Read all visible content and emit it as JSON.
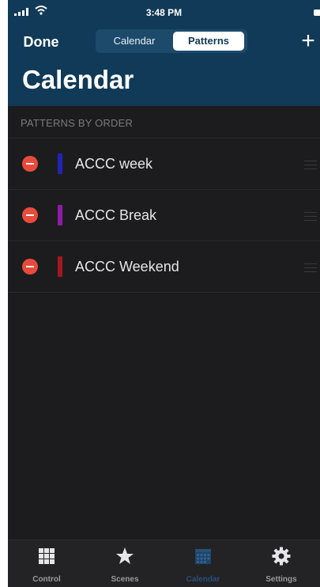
{
  "status_bar": {
    "time": "3:48 PM"
  },
  "nav": {
    "done_label": "Done",
    "add_label": "+"
  },
  "segments": [
    {
      "label": "Calendar",
      "selected": false
    },
    {
      "label": "Patterns",
      "selected": true
    }
  ],
  "title": "Calendar",
  "section_header": "PATTERNS BY ORDER",
  "patterns": [
    {
      "name": "ACCC  week",
      "color": "#2323b5"
    },
    {
      "name": "ACCC Break",
      "color": "#8f1aa6"
    },
    {
      "name": "ACCC Weekend",
      "color": "#a3181f"
    }
  ],
  "tabbar": [
    {
      "label": "Control",
      "icon": "grid-icon"
    },
    {
      "label": "Scenes",
      "icon": "star-icon"
    },
    {
      "label": "Calendar",
      "icon": "calendar-icon",
      "active": true
    },
    {
      "label": "Settings",
      "icon": "gear-icon"
    }
  ],
  "colors": {
    "header_bg": "#103a57",
    "list_bg": "#1c1c1e",
    "delete_red": "#e84b3c",
    "active_tab": "#27507a"
  }
}
